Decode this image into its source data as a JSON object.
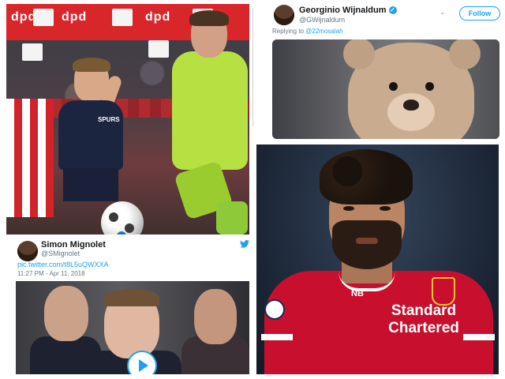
{
  "match_photo": {
    "ad_texts": [
      "dpd",
      "dpd",
      "dpd"
    ],
    "kit_crest": "SPURS"
  },
  "tweet_wijnaldum": {
    "name": "Georginio Wijnaldum",
    "handle": "@GWijnaldum",
    "follow_label": "Follow",
    "replying_to_prefix": "Replying to",
    "replying_to_handle": "@22mosalah"
  },
  "tweet_mignolet": {
    "name": "Simon Mignolet",
    "handle": "@SMignolet",
    "link": "pic.twitter.com/t8L5uQWXXA",
    "timestamp": "11:27 PM - Apr 11, 2018"
  },
  "salah_photo": {
    "sponsor_line1": "Standard",
    "sponsor_line2": "Chartered",
    "kit_brand": "NB"
  },
  "colors": {
    "twitter_blue": "#1da1f2",
    "liverpool_red": "#c8102e",
    "keeper_green": "#b7e043"
  },
  "icons": {
    "verified": "verified-badge-icon",
    "twitter": "twitter-bird-icon",
    "play": "play-icon",
    "chevron": "chevron-down-icon"
  }
}
